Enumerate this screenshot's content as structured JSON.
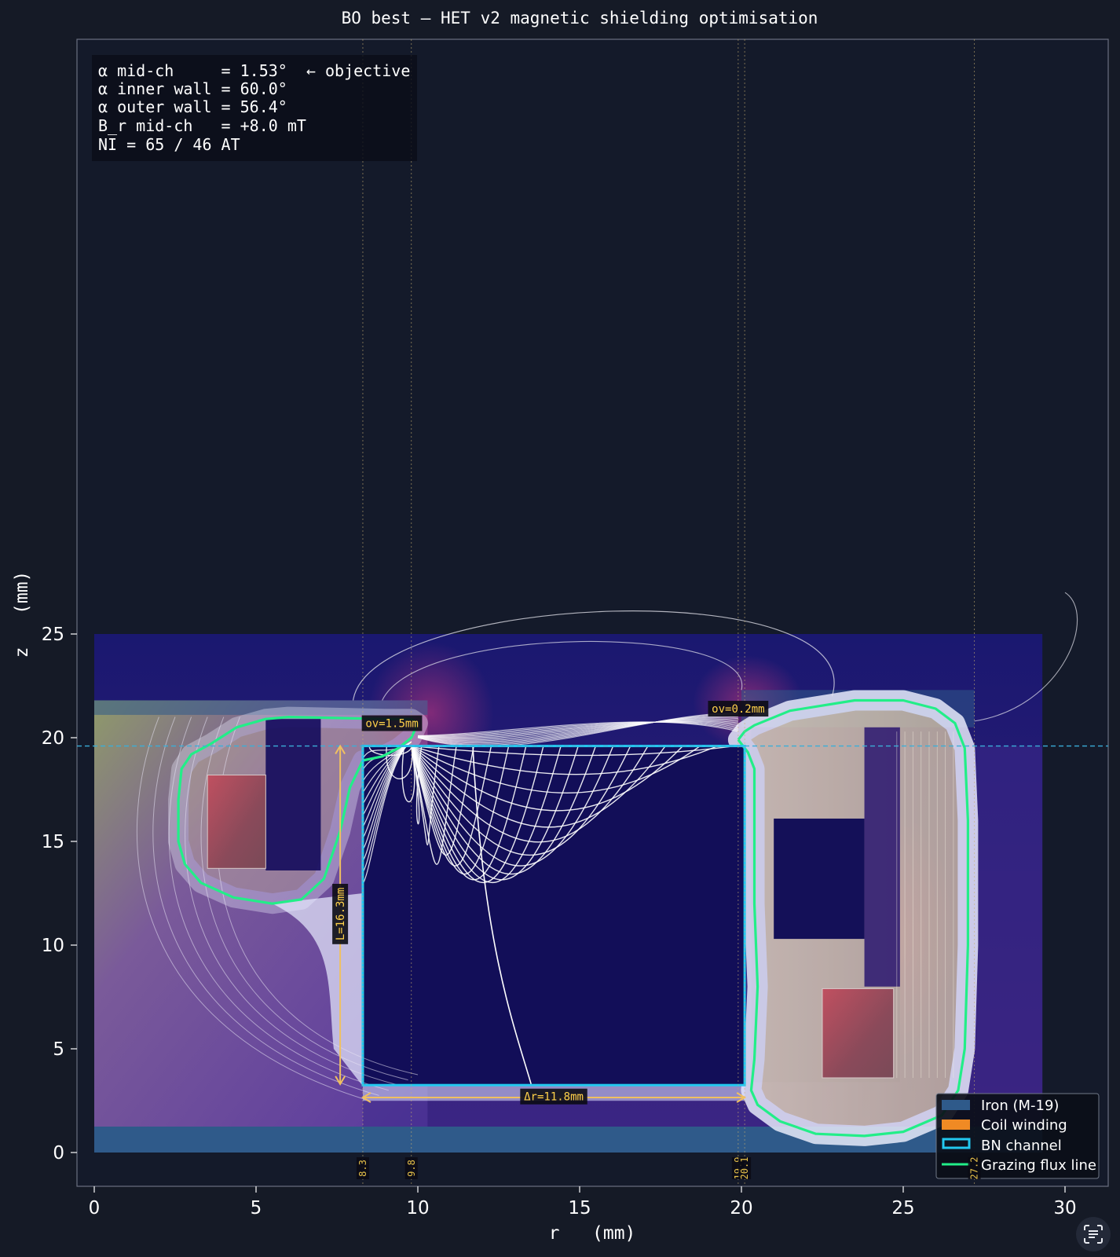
{
  "chart_data": {
    "type": "heatmap",
    "title": "BO best — HET v2 magnetic shielding optimisation",
    "xlabel": "r   (mm)",
    "ylabel": "z   (mm)",
    "xlim": [
      -0.5,
      31.2
    ],
    "ylim": [
      -0.7,
      26.7
    ],
    "x_ticks": [
      "0",
      "5",
      "10",
      "15",
      "20",
      "25",
      "30"
    ],
    "y_ticks": [
      "0",
      "5",
      "10",
      "15",
      "20",
      "25"
    ],
    "grid": false,
    "legend_position": "lower-right",
    "info_lines": [
      "α mid-ch     = 1.53°  ← objective",
      "α inner wall = 60.0°",
      "α outer wall = 56.4°",
      "B_r mid-ch   = +8.0 mT",
      "NI = 65 / 46 AT"
    ],
    "legend": [
      {
        "label": "Iron (M-19)",
        "color": "#2f5a8a",
        "kind": "patch"
      },
      {
        "label": "Coil winding",
        "color": "#f08a24",
        "kind": "patch"
      },
      {
        "label": "BN channel",
        "color": "#22c8f0",
        "kind": "outline"
      },
      {
        "label": "Grazing flux line",
        "color": "#22ee88",
        "kind": "line"
      }
    ],
    "iron_regions": [
      {
        "r0": 0,
        "r1": 29.3,
        "z0": 0,
        "z1": 1.25
      },
      {
        "r0": 0,
        "r1": 10.3,
        "z0": 21.1,
        "z1": 21.8
      },
      {
        "r0": 20.0,
        "r1": 27.2,
        "z0": 21.1,
        "z1": 22.3
      },
      {
        "r0": 20.0,
        "r1": 27.2,
        "z0": 20.5,
        "z1": 21.1
      }
    ],
    "coils": [
      {
        "r0": 3.5,
        "r1": 5.3,
        "z0": 13.7,
        "z1": 18.2
      },
      {
        "r0": 22.5,
        "r1": 24.7,
        "z0": 3.6,
        "z1": 7.9
      }
    ],
    "bn_channel": {
      "r0": 8.3,
      "r1": 20.1,
      "z0": 3.25,
      "z1": 19.6
    },
    "midchannel_z": 19.6,
    "vertical_markers": [
      {
        "r": 8.3,
        "label": "8.3"
      },
      {
        "r": 9.8,
        "label": "9.8"
      },
      {
        "r": 19.9,
        "label": "19.9"
      },
      {
        "r": 20.1,
        "label": "20.1"
      },
      {
        "r": 27.2,
        "label": "27.2"
      }
    ],
    "annotations": [
      {
        "text": "ov=1.5mm",
        "r": 9.2,
        "z": 20.7
      },
      {
        "text": "ov=0.2mm",
        "r": 19.9,
        "z": 21.4
      },
      {
        "text": "L=16.3mm",
        "r": 7.6,
        "z": 11.5,
        "vertical": true
      },
      {
        "text": "Δr=11.8mm",
        "r": 14.2,
        "z": 2.7
      }
    ],
    "dim_arrows": {
      "L": {
        "r": 7.6,
        "z0": 3.3,
        "z1": 19.6
      },
      "dr": {
        "z": 2.65,
        "r0": 8.3,
        "r1": 20.1
      }
    },
    "grazing_flux_line": [
      [
        10.0,
        20.7
      ],
      [
        9.8,
        20.9
      ],
      [
        9.0,
        20.9
      ],
      [
        6.0,
        21.0
      ],
      [
        5.3,
        20.9
      ],
      [
        4.4,
        20.5
      ],
      [
        3.6,
        19.7
      ],
      [
        3.0,
        19.2
      ],
      [
        2.7,
        18.5
      ],
      [
        2.6,
        17.0
      ],
      [
        2.6,
        15.0
      ],
      [
        2.8,
        13.9
      ],
      [
        3.3,
        13.0
      ],
      [
        4.3,
        12.3
      ],
      [
        5.5,
        12.0
      ],
      [
        6.4,
        12.2
      ],
      [
        7.1,
        13.2
      ],
      [
        7.6,
        15.5
      ],
      [
        7.9,
        17.6
      ],
      [
        8.3,
        18.9
      ],
      [
        8.9,
        19.1
      ],
      [
        9.4,
        19.5
      ],
      [
        9.8,
        20.0
      ],
      [
        10.0,
        20.7
      ]
    ],
    "grazing_flux_line_outer": [
      [
        19.9,
        19.9
      ],
      [
        20.1,
        20.3
      ],
      [
        20.4,
        20.6
      ],
      [
        21.5,
        21.3
      ],
      [
        23.5,
        21.8
      ],
      [
        25.0,
        21.8
      ],
      [
        26.0,
        21.4
      ],
      [
        26.6,
        20.7
      ],
      [
        26.9,
        19.5
      ],
      [
        27.0,
        16.0
      ],
      [
        27.0,
        10.0
      ],
      [
        26.9,
        5.0
      ],
      [
        26.7,
        3.0
      ],
      [
        26.2,
        1.8
      ],
      [
        25.0,
        1.0
      ],
      [
        23.8,
        0.8
      ],
      [
        22.3,
        0.9
      ],
      [
        21.2,
        1.5
      ],
      [
        20.5,
        2.3
      ],
      [
        20.3,
        3.0
      ],
      [
        20.4,
        4.5
      ],
      [
        20.5,
        8.0
      ],
      [
        20.4,
        12.0
      ],
      [
        20.4,
        16.0
      ],
      [
        20.4,
        18.5
      ],
      [
        20.2,
        19.3
      ],
      [
        19.9,
        19.9
      ]
    ]
  },
  "ui": {
    "scan_icon_name": "scan-text-icon"
  }
}
